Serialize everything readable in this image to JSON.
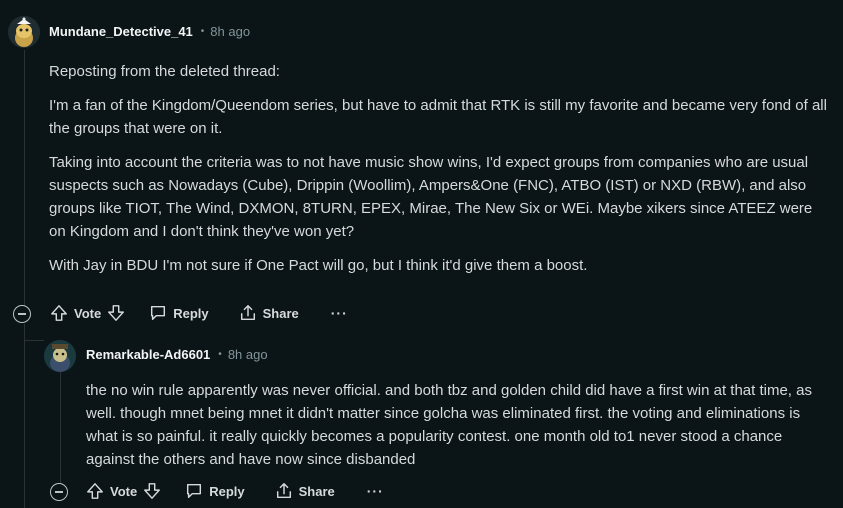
{
  "comment1": {
    "author": "Mundane_Detective_41",
    "separator": "•",
    "time": "8h ago",
    "paragraphs": [
      "Reposting from the deleted thread:",
      "I'm a fan of the Kingdom/Queendom series, but have to admit that RTK is still my favorite and became very fond of all the groups that were on it.",
      "Taking into account the criteria was to not have music show wins, I'd expect groups from companies who are usual suspects such as Nowadays (Cube), Drippin (Woollim), Ampers&One (FNC), ATBO (IST) or NXD (RBW), and also groups like TIOT, The Wind, DXMON, 8TURN, EPEX, Mirae, The New Six or WEi. Maybe xikers since ATEEZ were on Kingdom and I don't think they've won yet?",
      "With Jay in BDU I'm not sure if One Pact will go, but I think it'd give them a boost."
    ],
    "actions": {
      "vote": "Vote",
      "reply": "Reply",
      "share": "Share",
      "more": "···"
    }
  },
  "comment2": {
    "author": "Remarkable-Ad6601",
    "separator": "•",
    "time": "8h ago",
    "paragraphs": [
      "the no win rule apparently was never official. and both tbz and golden child did have a first win at that time, as well. though mnet being mnet it didn't matter since golcha was eliminated first. the voting and eliminations is what is so painful. it really quickly becomes a popularity contest. one month old to1 never stood a chance against the others and have now since disbanded"
    ],
    "actions": {
      "vote": "Vote",
      "reply": "Reply",
      "share": "Share",
      "more": "···"
    }
  },
  "colors": {
    "background": "#0b1416",
    "text": "#d7dadc",
    "meta": "#82959b",
    "thread_line": "#2a3236"
  }
}
